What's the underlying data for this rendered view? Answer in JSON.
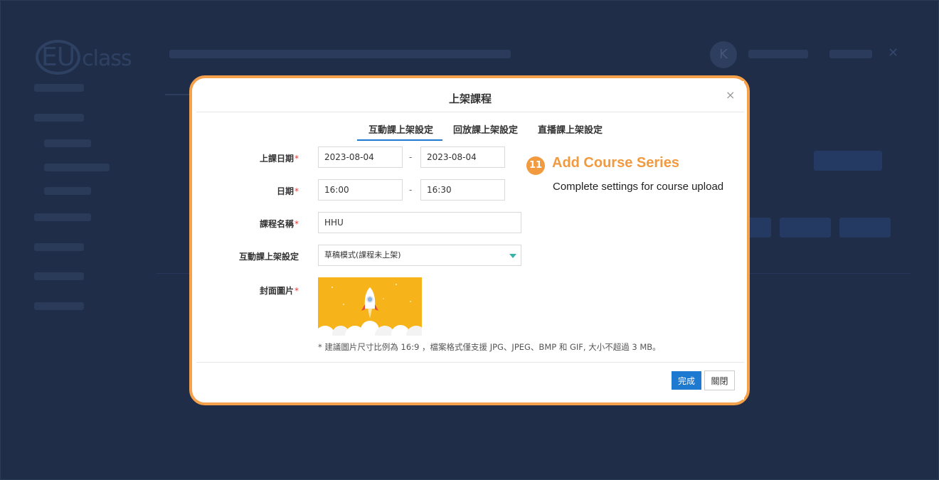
{
  "modal": {
    "title": "上架課程",
    "close_glyph": "×",
    "tabs": [
      {
        "label": "互動課上架設定",
        "active": true
      },
      {
        "label": "回放課上架設定",
        "active": false
      },
      {
        "label": "直播課上架設定",
        "active": false
      }
    ],
    "form": {
      "class_date": {
        "label": "上課日期",
        "required_mark": "*",
        "start": "2023-08-04",
        "separator": "-",
        "end": "2023-08-04"
      },
      "time": {
        "label": "日期",
        "required_mark": "*",
        "start": "16:00",
        "separator": "-",
        "end": "16:30"
      },
      "course_name": {
        "label": "課程名稱",
        "required_mark": "*",
        "value": "HHU"
      },
      "interactive_setting": {
        "label": "互動課上架設定",
        "selected": "草稿模式(課程未上架)",
        "arrow_icon": "caret-down-icon"
      },
      "cover": {
        "label": "封面圖片",
        "required_mark": "*",
        "image": "rocket-launch-illustration"
      },
      "hint": "* 建議圖片尺寸比例為 16:9 ，檔案格式僅支援 JPG、JPEG、BMP 和 GIF, 大小不超過 3 MB。"
    },
    "buttons": {
      "done": "完成",
      "close": "關閉"
    }
  },
  "callout": {
    "number": "11",
    "title": "Add Course Series",
    "description": "Complete settings for course upload"
  },
  "background": {
    "avatar_initial": "K"
  },
  "colors": {
    "overlay": "#1f2d48",
    "highlight_border": "#f5a04a",
    "accent": "#f29a3f",
    "primary_button": "#1e7ad0",
    "required": "#e53935",
    "select_arrow": "#36b3a7"
  }
}
